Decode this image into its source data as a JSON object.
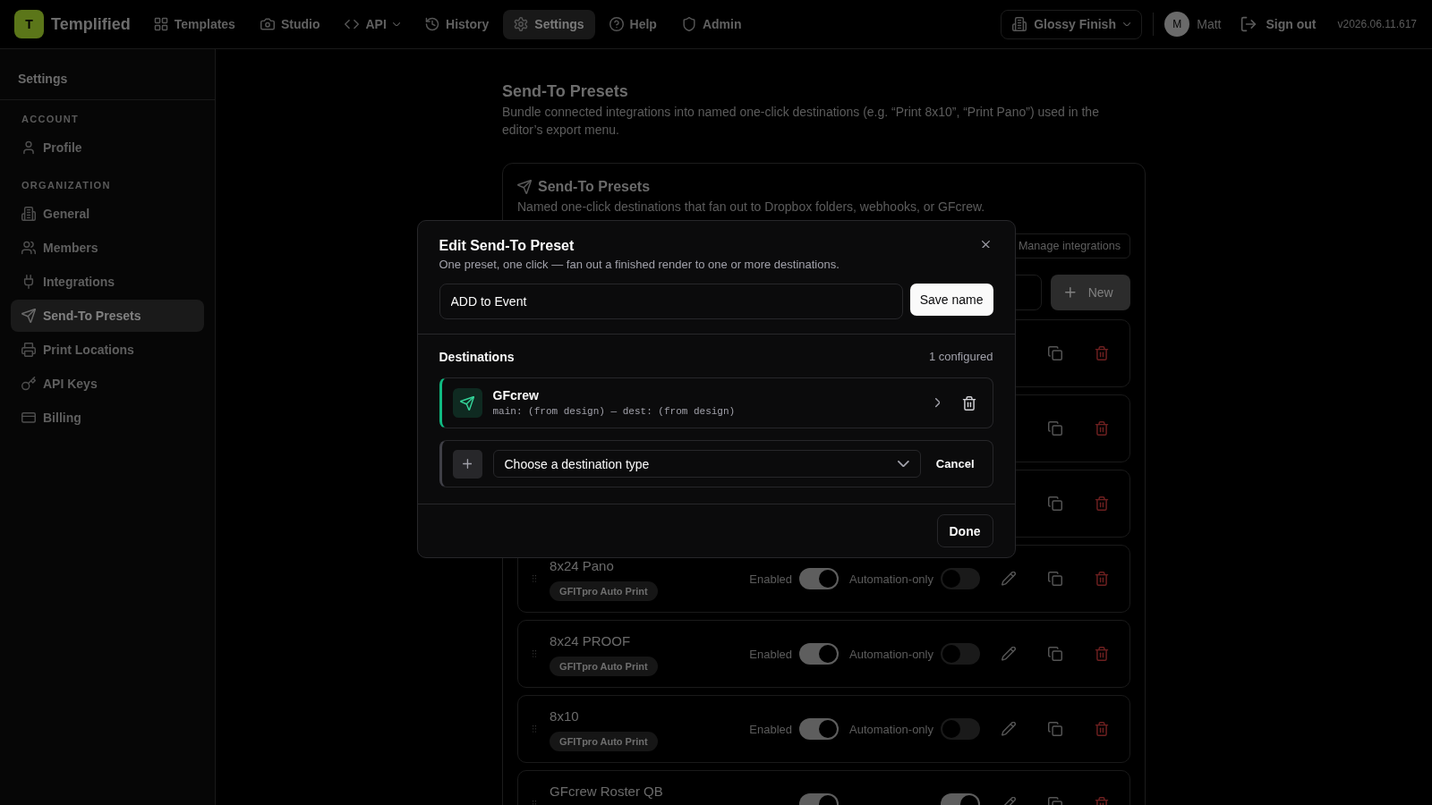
{
  "topbar": {
    "logo": "T",
    "brand": "Templified",
    "nav": [
      {
        "label": "Templates",
        "kind": "link",
        "selected": false
      },
      {
        "label": "Studio",
        "kind": "link",
        "selected": false
      },
      {
        "label": "API",
        "kind": "menu",
        "selected": false
      },
      {
        "label": "History",
        "kind": "link",
        "selected": false
      },
      {
        "label": "Settings",
        "kind": "link",
        "selected": true
      },
      {
        "label": "Help",
        "kind": "link",
        "selected": false
      },
      {
        "label": "Admin",
        "kind": "link",
        "selected": false
      }
    ],
    "workspace": "Glossy Finish",
    "avatar": "M",
    "user": "Matt",
    "sign_out": "Sign out",
    "version": "v2026.06.11.617"
  },
  "sidebar": {
    "title": "Settings",
    "sections": [
      {
        "heading": "ACCOUNT",
        "items": [
          {
            "label": "Profile",
            "selected": false
          }
        ]
      },
      {
        "heading": "ORGANIZATION",
        "items": [
          {
            "label": "General",
            "selected": false
          },
          {
            "label": "Members",
            "selected": false
          },
          {
            "label": "Integrations",
            "selected": false
          },
          {
            "label": "Send-To Presets",
            "selected": true
          },
          {
            "label": "Print Locations",
            "selected": false
          },
          {
            "label": "API Keys",
            "selected": false
          },
          {
            "label": "Billing",
            "selected": false
          }
        ]
      }
    ]
  },
  "page": {
    "title": "Send-To Presets",
    "description": "Bundle connected integrations into named one-click destinations (e.g. “Print 8x10”, “Print Pano”) used in the editor’s export menu."
  },
  "card": {
    "title": "Send-To Presets",
    "subtitle": "Named one-click destinations that fan out to Dropbox folders, webhooks, or GFcrew.",
    "manage_button": "Manage integrations",
    "new_button": "New",
    "presets": [
      {
        "kind": "covered"
      },
      {
        "kind": "covered"
      },
      {
        "kind": "covered"
      },
      {
        "kind": "full",
        "name": "8x24 Pano",
        "tag": "GFITpro Auto Print",
        "toggles": [
          {
            "label": "Enabled",
            "on": true
          },
          {
            "label": "Automation-only",
            "on": false
          }
        ]
      },
      {
        "kind": "full",
        "name": "8x24 PROOF",
        "tag": "GFITpro Auto Print",
        "toggles": [
          {
            "label": "Enabled",
            "on": true
          },
          {
            "label": "Automation-only",
            "on": false
          }
        ]
      },
      {
        "kind": "full",
        "name": "8x10",
        "tag": "GFITpro Auto Print",
        "toggles": [
          {
            "label": "Enabled",
            "on": true
          },
          {
            "label": "Automation-only",
            "on": false
          }
        ]
      },
      {
        "kind": "full",
        "name": "GFcrew Roster QB",
        "toggles": [
          {
            "on": true
          },
          {
            "on": true
          }
        ]
      }
    ]
  },
  "modal": {
    "title": "Edit Send-To Preset",
    "subtitle": "One preset, one click — fan out a finished render to one or more destinations.",
    "name_field": {
      "value": "ADD to Event"
    },
    "save_button": "Save name",
    "destinations_heading": "Destinations",
    "destinations_count": "1 configured",
    "destinations": [
      {
        "name": "GFcrew",
        "detail": "main: (from design) — dest: (from design)"
      }
    ],
    "add_destination": {
      "placeholder": "Choose a destination type",
      "cancel_button": "Cancel"
    },
    "done_button": "Done"
  }
}
